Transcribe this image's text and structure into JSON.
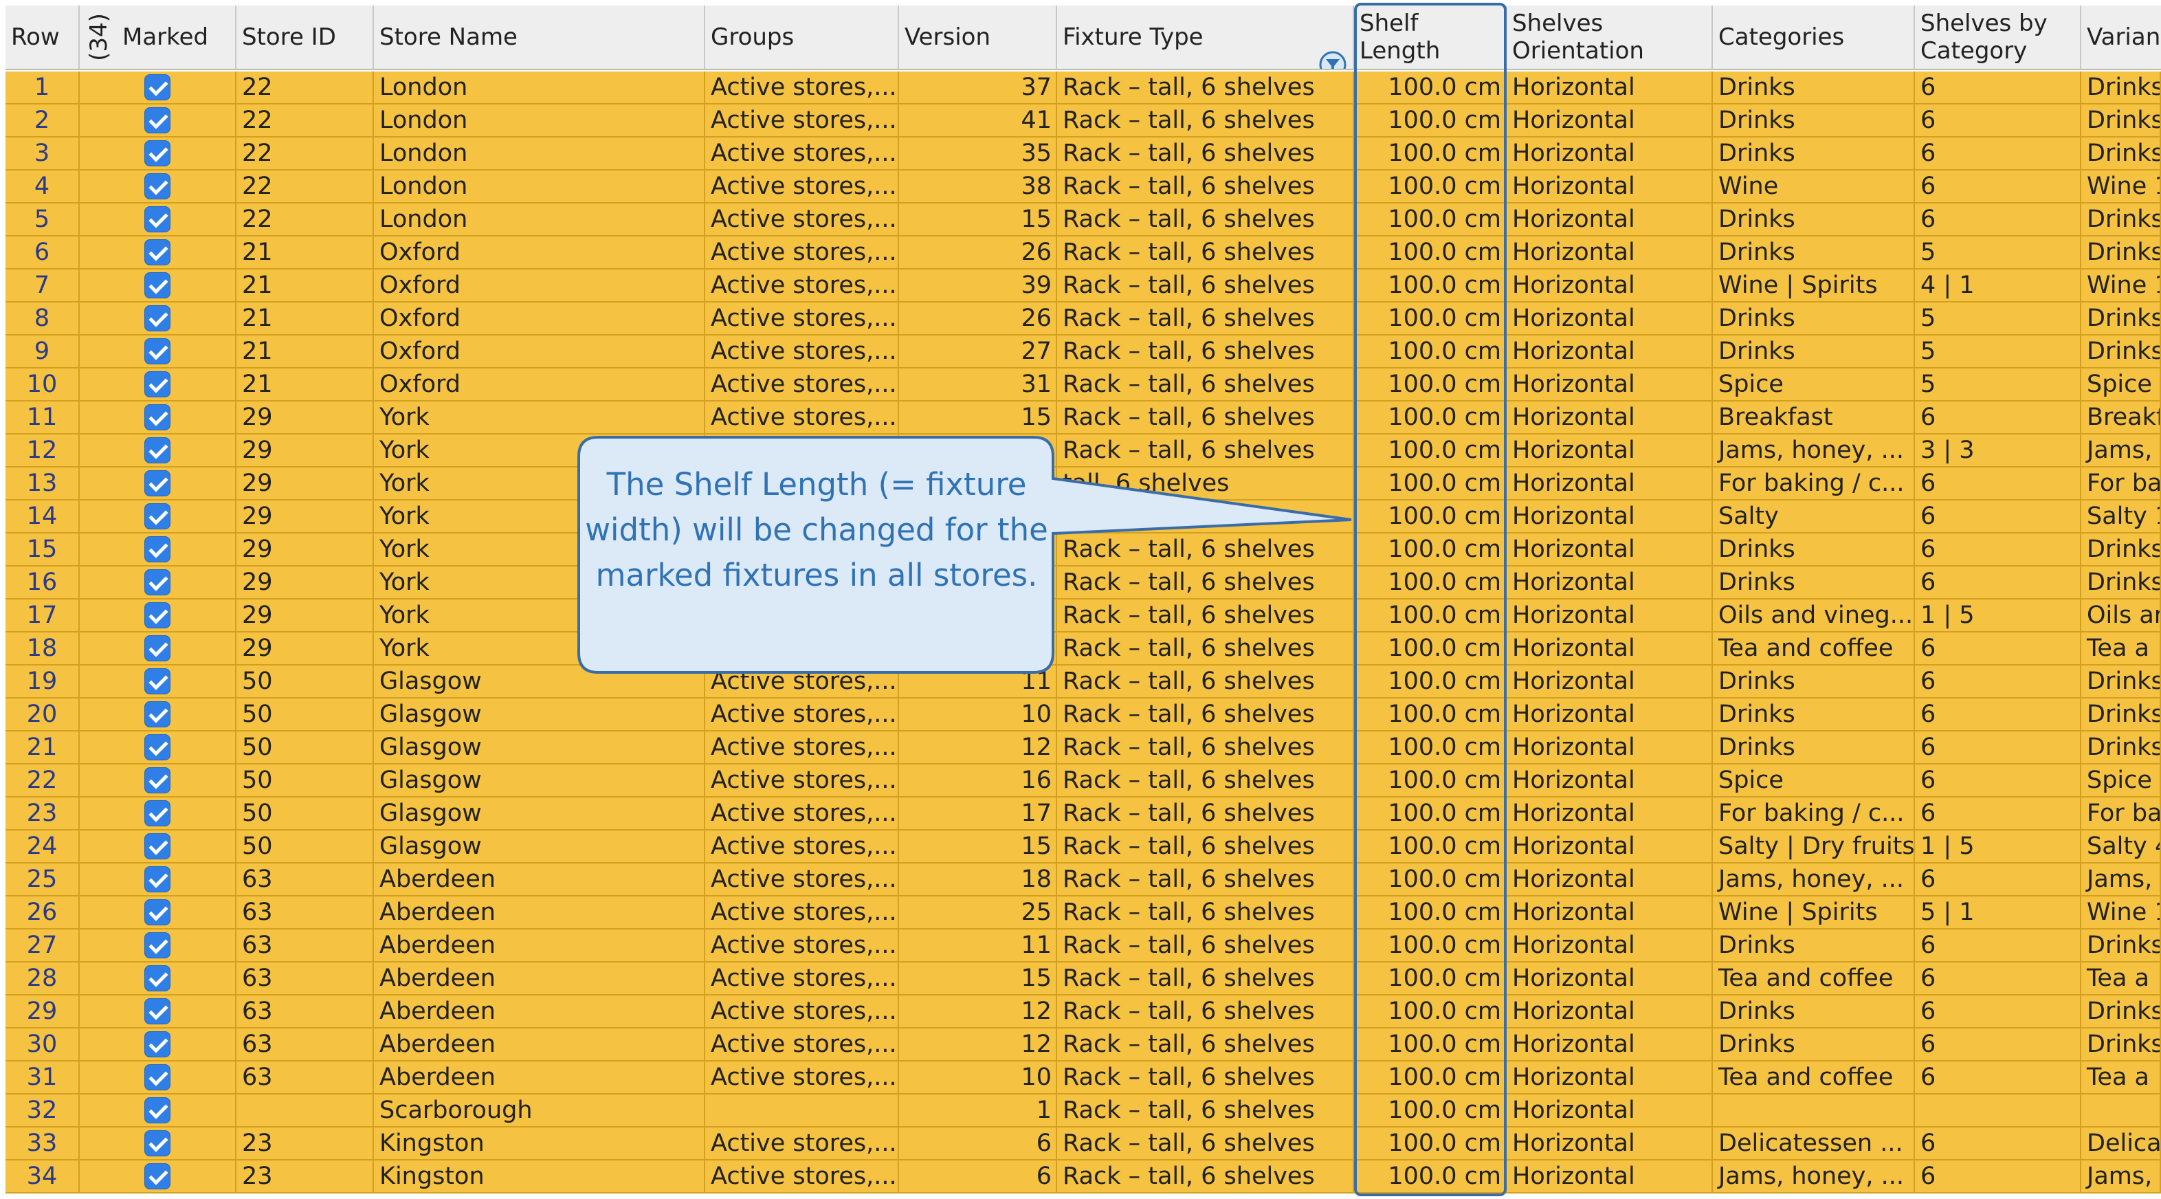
{
  "headers": {
    "row": "Row",
    "count": "(34)",
    "marked": "Marked",
    "store_id": "Store ID",
    "store_name": "Store Name",
    "groups": "Groups",
    "version": "Version",
    "fixture_type": "Fixture Type",
    "shelf_length": "Shelf Length",
    "shelves_orientation": "Shelves\nOrientation",
    "categories": "Categories",
    "shelves_by_category": "Shelves by\nCategory",
    "variant": "Varian"
  },
  "filter_icon": "filter-funnel-icon",
  "callout": {
    "text": "The Shelf Length (= fixture width) will be changed for the marked fixtures in all stores."
  },
  "colors": {
    "row_background": "#f5c242",
    "highlight": "#3a6da8",
    "callout_text": "#2f73b5",
    "checkbox": "#2f7fe6"
  },
  "rows": [
    {
      "row": "1",
      "marked": true,
      "store_id": "22",
      "store_name": "London",
      "groups": "Active stores,...",
      "version": "37",
      "fixture_type": "Rack – tall, 6 shelves",
      "shelf_length": "100.0 cm",
      "orientation": "Horizontal",
      "categories": "Drinks",
      "shelves_by_category": "6",
      "variant": "Drinks"
    },
    {
      "row": "2",
      "marked": true,
      "store_id": "22",
      "store_name": "London",
      "groups": "Active stores,...",
      "version": "41",
      "fixture_type": "Rack – tall, 6 shelves",
      "shelf_length": "100.0 cm",
      "orientation": "Horizontal",
      "categories": "Drinks",
      "shelves_by_category": "6",
      "variant": "Drinks"
    },
    {
      "row": "3",
      "marked": true,
      "store_id": "22",
      "store_name": "London",
      "groups": "Active stores,...",
      "version": "35",
      "fixture_type": "Rack – tall, 6 shelves",
      "shelf_length": "100.0 cm",
      "orientation": "Horizontal",
      "categories": "Drinks",
      "shelves_by_category": "6",
      "variant": "Drinks"
    },
    {
      "row": "4",
      "marked": true,
      "store_id": "22",
      "store_name": "London",
      "groups": "Active stores,...",
      "version": "38",
      "fixture_type": "Rack – tall, 6 shelves",
      "shelf_length": "100.0 cm",
      "orientation": "Horizontal",
      "categories": "Wine",
      "shelves_by_category": "6",
      "variant": "Wine 1"
    },
    {
      "row": "5",
      "marked": true,
      "store_id": "22",
      "store_name": "London",
      "groups": "Active stores,...",
      "version": "15",
      "fixture_type": "Rack – tall, 6 shelves",
      "shelf_length": "100.0 cm",
      "orientation": "Horizontal",
      "categories": "Drinks",
      "shelves_by_category": "6",
      "variant": "Drinks"
    },
    {
      "row": "6",
      "marked": true,
      "store_id": "21",
      "store_name": "Oxford",
      "groups": "Active stores,...",
      "version": "26",
      "fixture_type": "Rack – tall, 6 shelves",
      "shelf_length": "100.0 cm",
      "orientation": "Horizontal",
      "categories": "Drinks",
      "shelves_by_category": "5",
      "variant": "Drinks"
    },
    {
      "row": "7",
      "marked": true,
      "store_id": "21",
      "store_name": "Oxford",
      "groups": "Active stores,...",
      "version": "39",
      "fixture_type": "Rack – tall, 6 shelves",
      "shelf_length": "100.0 cm",
      "orientation": "Horizontal",
      "categories": "Wine | Spirits",
      "shelves_by_category": "4 | 1",
      "variant": "Wine 1"
    },
    {
      "row": "8",
      "marked": true,
      "store_id": "21",
      "store_name": "Oxford",
      "groups": "Active stores,...",
      "version": "26",
      "fixture_type": "Rack – tall, 6 shelves",
      "shelf_length": "100.0 cm",
      "orientation": "Horizontal",
      "categories": "Drinks",
      "shelves_by_category": "5",
      "variant": "Drinks"
    },
    {
      "row": "9",
      "marked": true,
      "store_id": "21",
      "store_name": "Oxford",
      "groups": "Active stores,...",
      "version": "27",
      "fixture_type": "Rack – tall, 6 shelves",
      "shelf_length": "100.0 cm",
      "orientation": "Horizontal",
      "categories": "Drinks",
      "shelves_by_category": "5",
      "variant": "Drinks"
    },
    {
      "row": "10",
      "marked": true,
      "store_id": "21",
      "store_name": "Oxford",
      "groups": "Active stores,...",
      "version": "31",
      "fixture_type": "Rack – tall, 6 shelves",
      "shelf_length": "100.0 cm",
      "orientation": "Horizontal",
      "categories": "Spice",
      "shelves_by_category": "5",
      "variant": "Spice"
    },
    {
      "row": "11",
      "marked": true,
      "store_id": "29",
      "store_name": "York",
      "groups": "Active stores,...",
      "version": "15",
      "fixture_type": "Rack – tall, 6 shelves",
      "shelf_length": "100.0 cm",
      "orientation": "Horizontal",
      "categories": "Breakfast",
      "shelves_by_category": "6",
      "variant": "Breakf"
    },
    {
      "row": "12",
      "marked": true,
      "store_id": "29",
      "store_name": "York",
      "groups": "",
      "version": "",
      "fixture_type": "Rack – tall, 6 shelves",
      "shelf_length": "100.0 cm",
      "orientation": "Horizontal",
      "categories": "Jams, honey, ...",
      "shelves_by_category": "3 | 3",
      "variant": "Jams,"
    },
    {
      "row": "13",
      "marked": true,
      "store_id": "29",
      "store_name": "York",
      "groups": "",
      "version": "",
      "fixture_type": "tall, 6 shelves",
      "shelf_length": "100.0 cm",
      "orientation": "Horizontal",
      "categories": "For baking / c...",
      "shelves_by_category": "6",
      "variant": "For ba"
    },
    {
      "row": "14",
      "marked": true,
      "store_id": "29",
      "store_name": "York",
      "groups": "",
      "version": "",
      "fixture_type": "",
      "shelf_length": "100.0 cm",
      "orientation": "Horizontal",
      "categories": "Salty",
      "shelves_by_category": "6",
      "variant": "Salty 1"
    },
    {
      "row": "15",
      "marked": true,
      "store_id": "29",
      "store_name": "York",
      "groups": "",
      "version": "",
      "fixture_type": "Rack – tall, 6 shelves",
      "shelf_length": "100.0 cm",
      "orientation": "Horizontal",
      "categories": "Drinks",
      "shelves_by_category": "6",
      "variant": "Drinks"
    },
    {
      "row": "16",
      "marked": true,
      "store_id": "29",
      "store_name": "York",
      "groups": "",
      "version": "",
      "fixture_type": "Rack – tall, 6 shelves",
      "shelf_length": "100.0 cm",
      "orientation": "Horizontal",
      "categories": "Drinks",
      "shelves_by_category": "6",
      "variant": "Drinks"
    },
    {
      "row": "17",
      "marked": true,
      "store_id": "29",
      "store_name": "York",
      "groups": "",
      "version": "",
      "fixture_type": "Rack – tall, 6 shelves",
      "shelf_length": "100.0 cm",
      "orientation": "Horizontal",
      "categories": "Oils and vineg...",
      "shelves_by_category": "1 | 5",
      "variant": "Oils ar"
    },
    {
      "row": "18",
      "marked": true,
      "store_id": "29",
      "store_name": "York",
      "groups": "",
      "version": "",
      "fixture_type": "Rack – tall, 6 shelves",
      "shelf_length": "100.0 cm",
      "orientation": "Horizontal",
      "categories": "Tea and coffee",
      "shelves_by_category": "6",
      "variant": "Tea a"
    },
    {
      "row": "19",
      "marked": true,
      "store_id": "50",
      "store_name": "Glasgow",
      "groups": "Active stores,...",
      "version": "11",
      "fixture_type": "Rack – tall, 6 shelves",
      "shelf_length": "100.0 cm",
      "orientation": "Horizontal",
      "categories": "Drinks",
      "shelves_by_category": "6",
      "variant": "Drinks"
    },
    {
      "row": "20",
      "marked": true,
      "store_id": "50",
      "store_name": "Glasgow",
      "groups": "Active stores,...",
      "version": "10",
      "fixture_type": "Rack – tall, 6 shelves",
      "shelf_length": "100.0 cm",
      "orientation": "Horizontal",
      "categories": "Drinks",
      "shelves_by_category": "6",
      "variant": "Drinks"
    },
    {
      "row": "21",
      "marked": true,
      "store_id": "50",
      "store_name": "Glasgow",
      "groups": "Active stores,...",
      "version": "12",
      "fixture_type": "Rack – tall, 6 shelves",
      "shelf_length": "100.0 cm",
      "orientation": "Horizontal",
      "categories": "Drinks",
      "shelves_by_category": "6",
      "variant": "Drinks"
    },
    {
      "row": "22",
      "marked": true,
      "store_id": "50",
      "store_name": "Glasgow",
      "groups": "Active stores,...",
      "version": "16",
      "fixture_type": "Rack – tall, 6 shelves",
      "shelf_length": "100.0 cm",
      "orientation": "Horizontal",
      "categories": "Spice",
      "shelves_by_category": "6",
      "variant": "Spice"
    },
    {
      "row": "23",
      "marked": true,
      "store_id": "50",
      "store_name": "Glasgow",
      "groups": "Active stores,...",
      "version": "17",
      "fixture_type": "Rack – tall, 6 shelves",
      "shelf_length": "100.0 cm",
      "orientation": "Horizontal",
      "categories": "For baking / c...",
      "shelves_by_category": "6",
      "variant": "For ba"
    },
    {
      "row": "24",
      "marked": true,
      "store_id": "50",
      "store_name": "Glasgow",
      "groups": "Active stores,...",
      "version": "15",
      "fixture_type": "Rack – tall, 6 shelves",
      "shelf_length": "100.0 cm",
      "orientation": "Horizontal",
      "categories": "Salty | Dry fruits",
      "shelves_by_category": "1 | 5",
      "variant": "Salty 4"
    },
    {
      "row": "25",
      "marked": true,
      "store_id": "63",
      "store_name": "Aberdeen",
      "groups": "Active stores,...",
      "version": "18",
      "fixture_type": "Rack – tall, 6 shelves",
      "shelf_length": "100.0 cm",
      "orientation": "Horizontal",
      "categories": "Jams, honey, ...",
      "shelves_by_category": "6",
      "variant": "Jams,"
    },
    {
      "row": "26",
      "marked": true,
      "store_id": "63",
      "store_name": "Aberdeen",
      "groups": "Active stores,...",
      "version": "25",
      "fixture_type": "Rack – tall, 6 shelves",
      "shelf_length": "100.0 cm",
      "orientation": "Horizontal",
      "categories": "Wine | Spirits",
      "shelves_by_category": "5 | 1",
      "variant": "Wine 1"
    },
    {
      "row": "27",
      "marked": true,
      "store_id": "63",
      "store_name": "Aberdeen",
      "groups": "Active stores,...",
      "version": "11",
      "fixture_type": "Rack – tall, 6 shelves",
      "shelf_length": "100.0 cm",
      "orientation": "Horizontal",
      "categories": "Drinks",
      "shelves_by_category": "6",
      "variant": "Drinks"
    },
    {
      "row": "28",
      "marked": true,
      "store_id": "63",
      "store_name": "Aberdeen",
      "groups": "Active stores,...",
      "version": "15",
      "fixture_type": "Rack – tall, 6 shelves",
      "shelf_length": "100.0 cm",
      "orientation": "Horizontal",
      "categories": "Tea and coffee",
      "shelves_by_category": "6",
      "variant": "Tea a"
    },
    {
      "row": "29",
      "marked": true,
      "store_id": "63",
      "store_name": "Aberdeen",
      "groups": "Active stores,...",
      "version": "12",
      "fixture_type": "Rack – tall, 6 shelves",
      "shelf_length": "100.0 cm",
      "orientation": "Horizontal",
      "categories": "Drinks",
      "shelves_by_category": "6",
      "variant": "Drinks"
    },
    {
      "row": "30",
      "marked": true,
      "store_id": "63",
      "store_name": "Aberdeen",
      "groups": "Active stores,...",
      "version": "12",
      "fixture_type": "Rack – tall, 6 shelves",
      "shelf_length": "100.0 cm",
      "orientation": "Horizontal",
      "categories": "Drinks",
      "shelves_by_category": "6",
      "variant": "Drinks"
    },
    {
      "row": "31",
      "marked": true,
      "store_id": "63",
      "store_name": "Aberdeen",
      "groups": "Active stores,...",
      "version": "10",
      "fixture_type": "Rack – tall, 6 shelves",
      "shelf_length": "100.0 cm",
      "orientation": "Horizontal",
      "categories": "Tea and coffee",
      "shelves_by_category": "6",
      "variant": "Tea a"
    },
    {
      "row": "32",
      "marked": true,
      "store_id": "",
      "store_name": "Scarborough",
      "groups": "",
      "version": "1",
      "fixture_type": "Rack – tall, 6 shelves",
      "shelf_length": "100.0 cm",
      "orientation": "Horizontal",
      "categories": "",
      "shelves_by_category": "",
      "variant": ""
    },
    {
      "row": "33",
      "marked": true,
      "store_id": "23",
      "store_name": "Kingston",
      "groups": "Active stores,...",
      "version": "6",
      "fixture_type": "Rack – tall, 6 shelves",
      "shelf_length": "100.0 cm",
      "orientation": "Horizontal",
      "categories": "Delicatessen ...",
      "shelves_by_category": "6",
      "variant": "Delica"
    },
    {
      "row": "34",
      "marked": true,
      "store_id": "23",
      "store_name": "Kingston",
      "groups": "Active stores,...",
      "version": "6",
      "fixture_type": "Rack – tall, 6 shelves",
      "shelf_length": "100.0 cm",
      "orientation": "Horizontal",
      "categories": "Jams, honey, ...",
      "shelves_by_category": "6",
      "variant": "Jams,"
    }
  ]
}
